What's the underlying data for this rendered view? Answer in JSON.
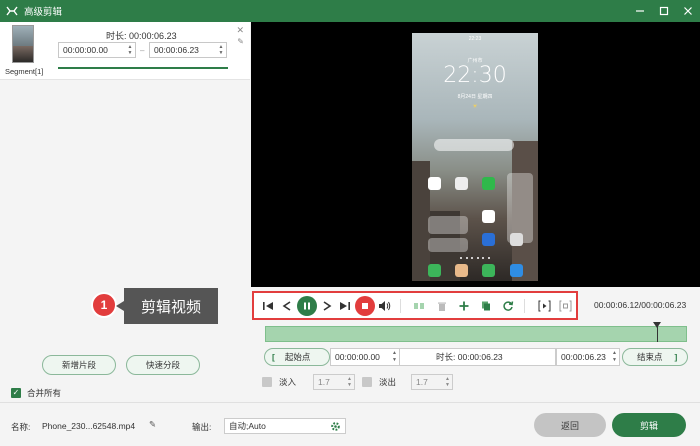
{
  "window": {
    "title": "高级剪辑"
  },
  "segment": {
    "label": "Segment[1]",
    "duration_label": "时长:",
    "duration_value": "00:00:06.23",
    "start_time": "00:00:00.00",
    "end_time": "00:00:06.23",
    "close_icon": "close-icon",
    "edit_icon": "pencil-icon"
  },
  "left_actions": {
    "add_segment": "新增片段",
    "quick_split": "快速分段",
    "merge_all": "合并所有",
    "merge_checked": true
  },
  "callout": {
    "number": "1",
    "text": "剪辑视频"
  },
  "phone_preview": {
    "status_time": "22:23",
    "location": "广州市",
    "clock": "22:30",
    "date": "8月24日 星期四",
    "weather": "☀"
  },
  "playback": {
    "time_readout": "00:00:06.12/00:00:06.23",
    "controls": [
      "jump-start-icon",
      "step-back-icon",
      "pause-icon",
      "step-forward-icon",
      "jump-end-icon",
      "stop-icon",
      "volume-icon",
      "split-icon",
      "delete-icon",
      "add-icon",
      "copy-icon",
      "reset-icon",
      "set-start-icon",
      "set-end-icon"
    ]
  },
  "timeline": {
    "playhead_position": 0.93
  },
  "range": {
    "start_btn": "起始点",
    "start_value": "00:00:00.00",
    "duration_label": "时长:",
    "duration_value": "00:00:06.23",
    "end_value": "00:00:06.23",
    "end_btn": "结束点"
  },
  "fade": {
    "fade_in_label": "淡入",
    "fade_in_value": "1.7",
    "fade_out_label": "淡出",
    "fade_out_value": "1.7"
  },
  "bottom": {
    "name_label": "名称:",
    "name_value": "Phone_230...62548.mp4",
    "output_label": "输出:",
    "output_value": "自动;Auto",
    "back_btn": "返回",
    "cut_btn": "剪辑"
  },
  "colors": {
    "accent": "#2e7d48",
    "callout_red": "#e23d3d"
  }
}
